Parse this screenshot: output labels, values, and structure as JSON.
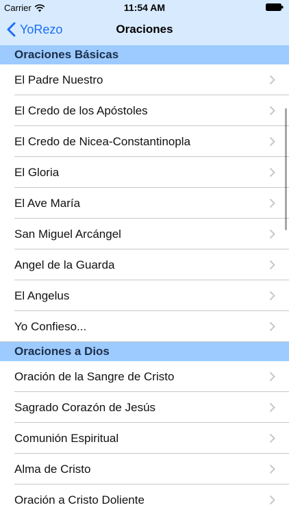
{
  "status_bar": {
    "carrier": "Carrier",
    "time": "11:54 AM"
  },
  "nav": {
    "back_label": "YoRezo",
    "title": "Oraciones"
  },
  "sections": [
    {
      "header": "Oraciones Básicas",
      "items": [
        "El Padre Nuestro",
        "El Credo de los Apóstoles",
        "El Credo de Nicea-Constantinopla",
        "El Gloria",
        "El Ave María",
        "San Miguel Arcángel",
        "Angel de la Guarda",
        "El Angelus",
        "Yo Confieso..."
      ]
    },
    {
      "header": "Oraciones a Dios",
      "items": [
        "Oración de la Sangre de Cristo",
        "Sagrado Corazón de Jesús",
        "Comunión Espiritual",
        "Alma de Cristo",
        "Oración a Cristo Doliente"
      ]
    }
  ],
  "colors": {
    "nav_background": "#d8eafe",
    "section_background": "#9dcbff",
    "accent": "#1a6ef5"
  },
  "icons": {
    "back": "chevron-left-icon",
    "disclosure": "chevron-right-icon",
    "wifi": "wifi-icon",
    "battery": "battery-icon"
  }
}
